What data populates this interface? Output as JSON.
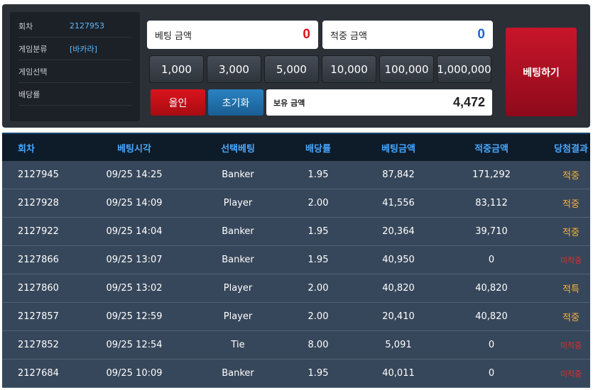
{
  "info": {
    "rows": [
      {
        "label": "회차",
        "value": "2127953"
      },
      {
        "label": "게임분류",
        "value": "[바카라]"
      },
      {
        "label": "게임선택",
        "value": ""
      },
      {
        "label": "배당률",
        "value": ""
      }
    ]
  },
  "bet_amount": {
    "label": "베팅 금액",
    "value": "0"
  },
  "win_amount": {
    "label": "적중 금액",
    "value": "0"
  },
  "chips": [
    "1,000",
    "3,000",
    "5,000",
    "10,000",
    "100,000",
    "1,000,000"
  ],
  "buttons": {
    "all_in": "올인",
    "reset": "초기화",
    "place_bet": "베팅하기"
  },
  "balance": {
    "label": "보유 금액",
    "value": "4,472"
  },
  "table": {
    "headers": [
      "회차",
      "베팅시각",
      "선택베팅",
      "배당률",
      "베팅금액",
      "적중금액",
      "당첨결과"
    ],
    "rows": [
      [
        "2127945",
        "09/25 14:25",
        "Banker",
        "1.95",
        "87,842",
        "171,292",
        "적중"
      ],
      [
        "2127928",
        "09/25 14:09",
        "Player",
        "2.00",
        "41,556",
        "83,112",
        "적중"
      ],
      [
        "2127922",
        "09/25 14:04",
        "Banker",
        "1.95",
        "20,364",
        "39,710",
        "적중"
      ],
      [
        "2127866",
        "09/25 13:07",
        "Banker",
        "1.95",
        "40,950",
        "0",
        "미적중"
      ],
      [
        "2127860",
        "09/25 13:02",
        "Player",
        "2.00",
        "40,820",
        "40,820",
        "적특"
      ],
      [
        "2127857",
        "09/25 12:59",
        "Player",
        "2.00",
        "20,410",
        "40,820",
        "적중"
      ],
      [
        "2127852",
        "09/25 12:54",
        "Tie",
        "8.00",
        "5,091",
        "0",
        "미적중"
      ],
      [
        "2127684",
        "09/25 10:09",
        "Banker",
        "1.95",
        "40,011",
        "0",
        "미적중"
      ]
    ],
    "result_colors": {
      "win": "#f5b13a",
      "lose": "#e52a2a"
    }
  }
}
